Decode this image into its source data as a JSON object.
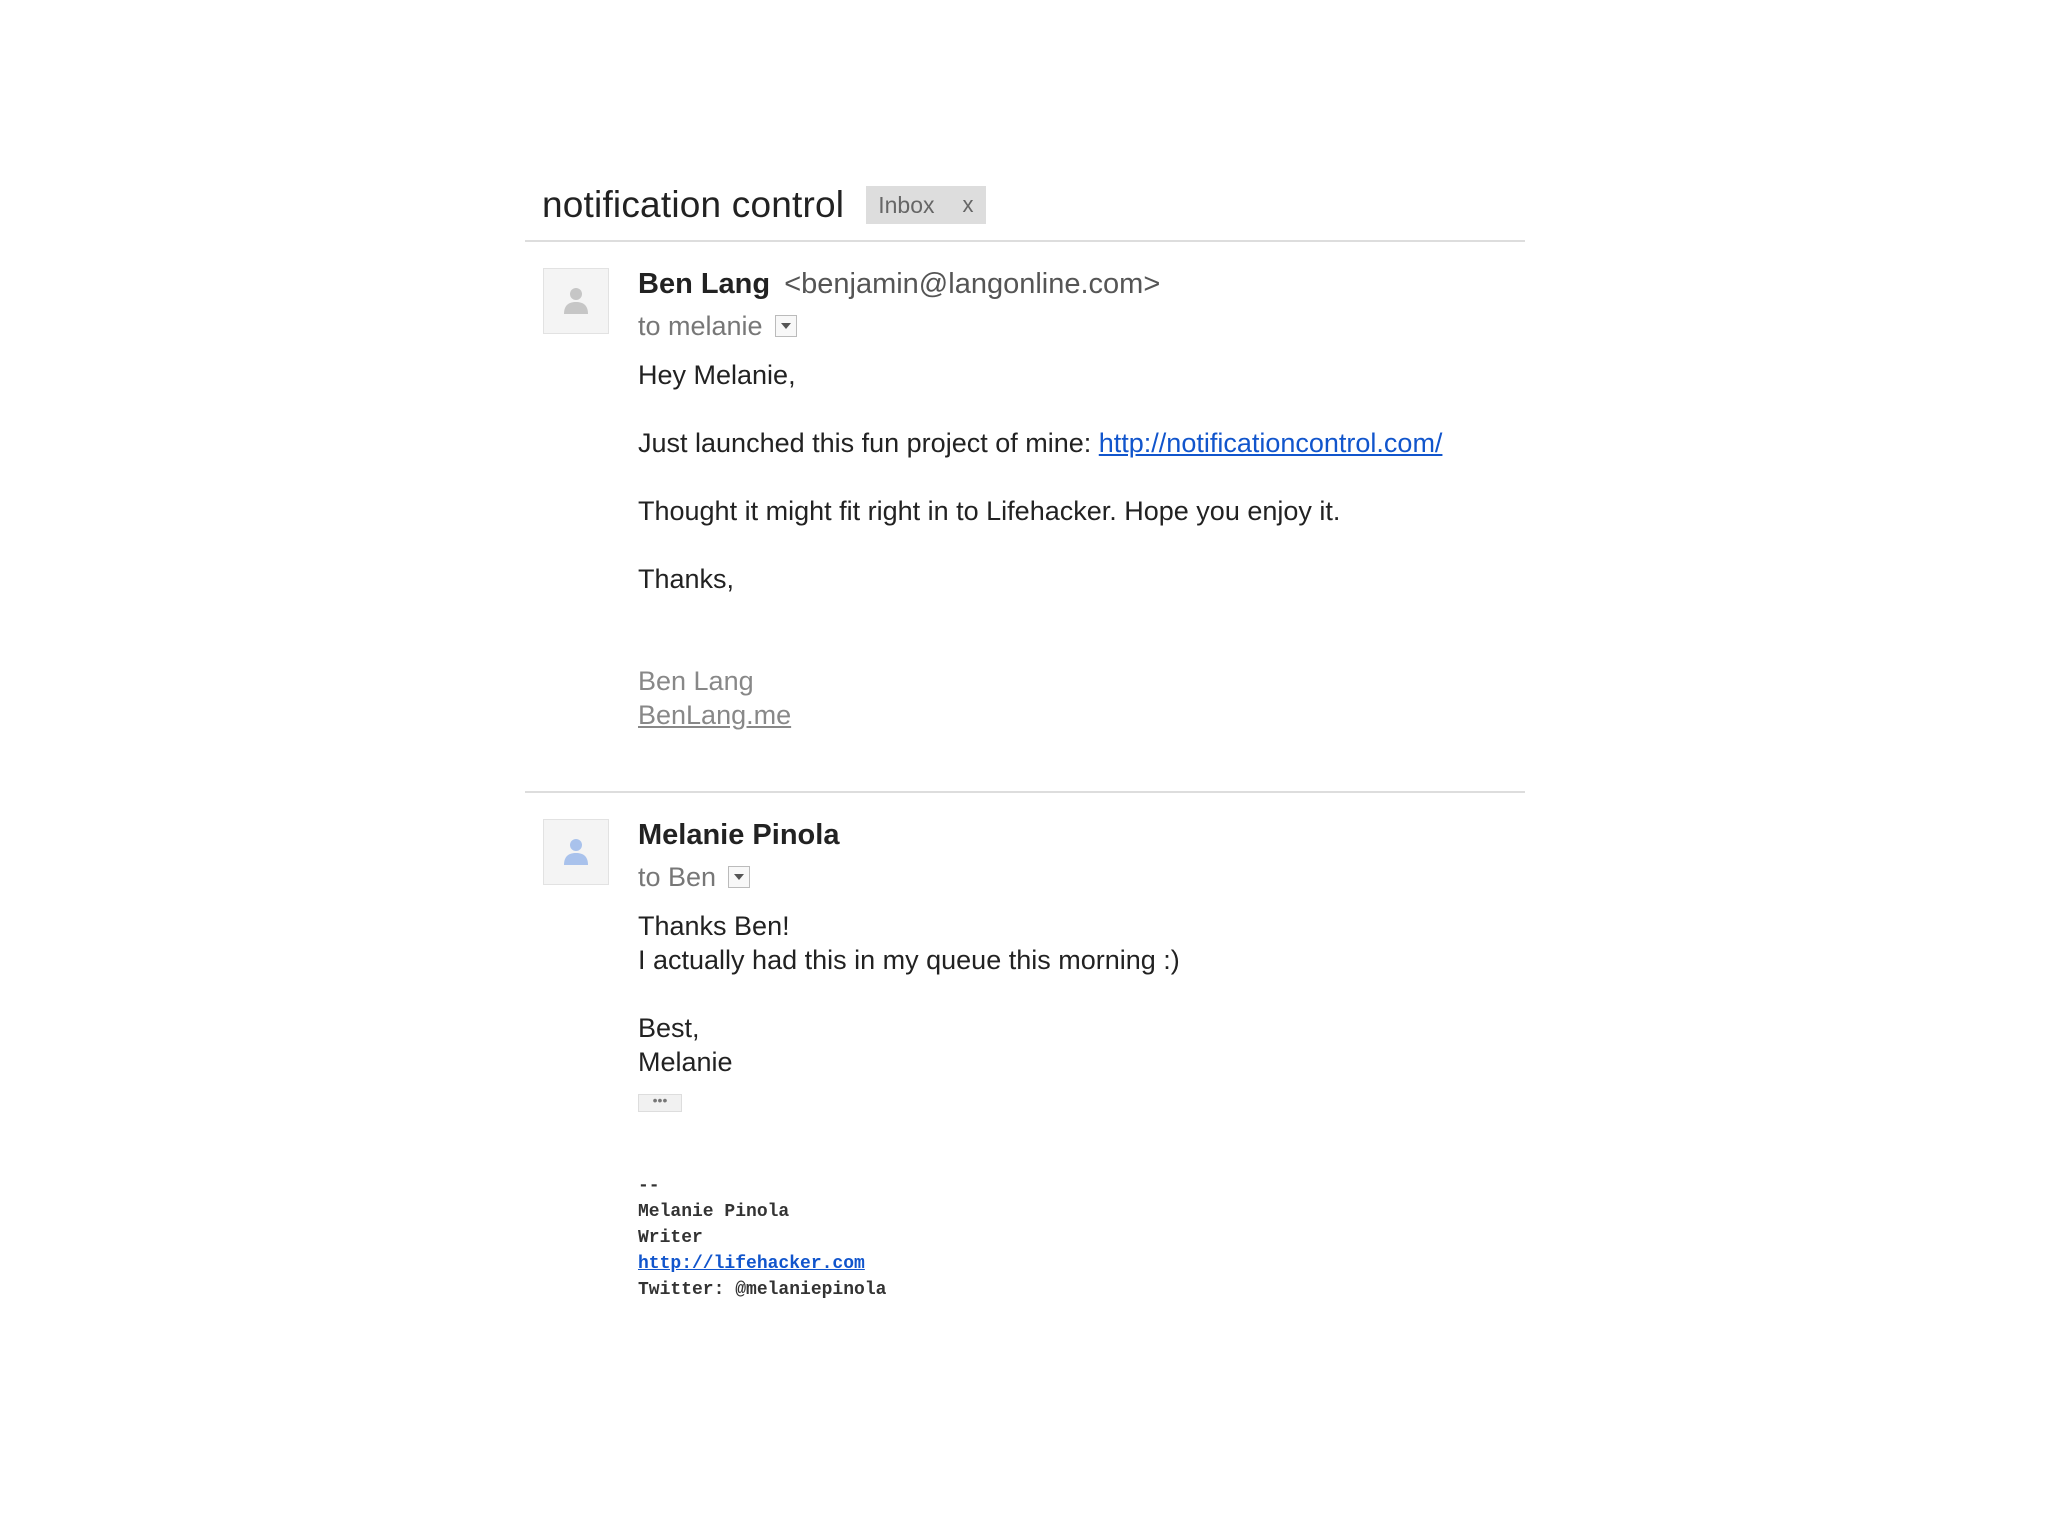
{
  "thread": {
    "subject": "notification control",
    "label": "Inbox",
    "label_remove": "x"
  },
  "messages": [
    {
      "sender_name": "Ben Lang",
      "sender_email": "<benjamin@langonline.com>",
      "to": "to melanie",
      "greeting": "Hey Melanie,",
      "line1_prefix": "Just launched this fun project of mine: ",
      "line1_link": "http://notificationcontrol.com/",
      "line2": "Thought it might fit right in to Lifehacker. Hope you enjoy it.",
      "closing": "Thanks,",
      "sig_name": "Ben Lang",
      "sig_link": "BenLang.me"
    },
    {
      "sender_name": "Melanie Pinola",
      "to": "to Ben",
      "line1": "Thanks Ben!",
      "line2": "I actually had this in my queue this morning :)",
      "closing": "Best,",
      "closing_name": "Melanie",
      "expand_label": "•••",
      "sig_dash": "--",
      "sig_name": "Melanie Pinola",
      "sig_title": "Writer",
      "sig_link": "http://lifehacker.com",
      "sig_twitter": "Twitter: @melaniepinola"
    }
  ],
  "icons": {
    "avatar": "person-silhouette-icon",
    "dropdown": "triangle-down-icon"
  },
  "colors": {
    "link": "#1155cc",
    "avatar_gray": "#c6c6c6",
    "avatar_blue": "#a9c2ec"
  }
}
